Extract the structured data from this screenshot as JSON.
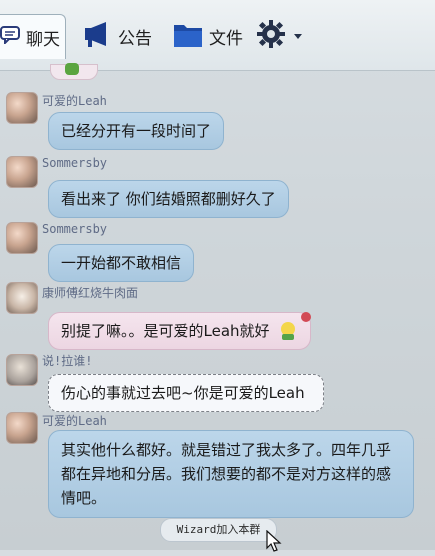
{
  "toolbar": {
    "tabs": [
      {
        "label": "聊天",
        "icon": "chat-icon"
      },
      {
        "label": "公告",
        "icon": "megaphone-icon"
      },
      {
        "label": "文件",
        "icon": "folder-icon"
      },
      {
        "label": "",
        "icon": "gear-icon"
      }
    ]
  },
  "messages": [
    {
      "name": "可爱的Leah",
      "text": "已经分开有一段时间了"
    },
    {
      "name": "Sommersby",
      "text": "看出来了 你们结婚照都删好久了"
    },
    {
      "name": "Sommersby",
      "text": "一开始都不敢相信"
    },
    {
      "name": "康师傅红烧牛肉面",
      "text": "别提了嘛。。是可爱的Leah就好"
    },
    {
      "name": "说!拉谁!",
      "text": "伤心的事就过去吧~你是可爱的Leah"
    },
    {
      "name": "可爱的Leah",
      "text": "其实他什么都好。就是错过了我太多了。四年几乎都在异地和分居。我们想要的都不是对方这样的感情吧。"
    }
  ],
  "system": {
    "join_notice": "Wizard加入本群"
  },
  "colors": {
    "bubble_blue": "#a8c7df",
    "bubble_pink": "#ecd6e2",
    "name_color": "#5f6b86"
  }
}
